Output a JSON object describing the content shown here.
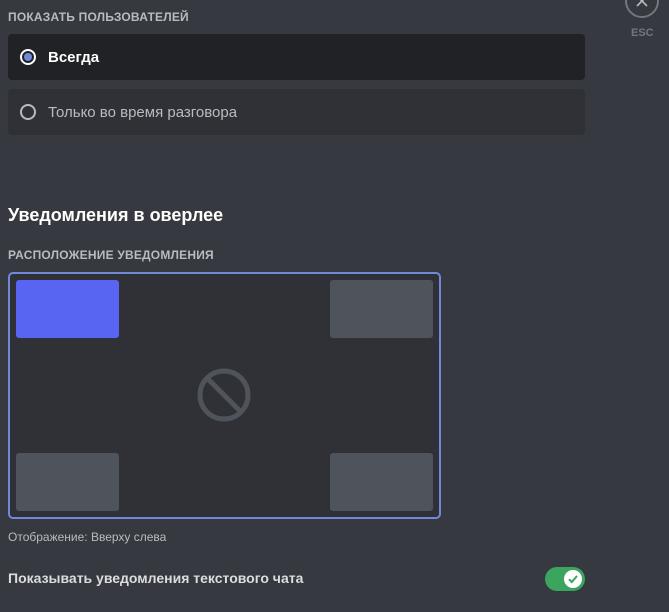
{
  "show_users": {
    "label": "ПОКАЗАТЬ ПОЛЬЗОВАТЕЛЕЙ",
    "options": [
      {
        "label": "Всегда",
        "selected": true
      },
      {
        "label": "Только во время разговора",
        "selected": false
      }
    ]
  },
  "notifications": {
    "heading": "Уведомления в оверлее",
    "position_label": "РАСПОЛОЖЕНИЕ УВЕДОМЛЕНИЯ",
    "selected_position": "top-left",
    "caption": "Отображение: Вверху слева"
  },
  "text_chat_toggle": {
    "label": "Показывать уведомления текстового чата",
    "enabled": true
  },
  "close": {
    "label": "ESC"
  },
  "colors": {
    "background": "#36393f",
    "accent": "#5865f2",
    "toggle_on": "#3ba55d",
    "picker_border": "#7289da"
  }
}
